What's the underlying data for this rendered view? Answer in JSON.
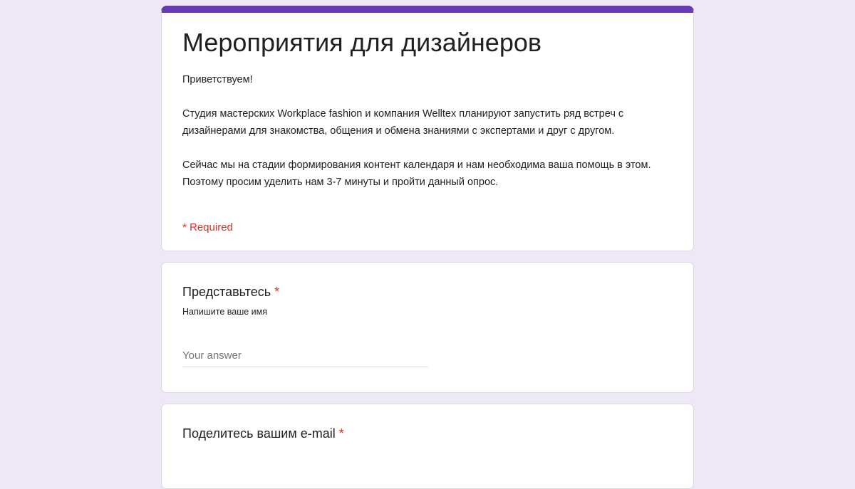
{
  "header": {
    "title": "Мероприятия для дизайнеров",
    "description": "Приветствуем!\n\nСтудия мастерских Workplace fashion и компания Welltex планируют запустить ряд встреч с дизайнерами для знакомства, общения и обмена знаниями с экспертами и друг с другом.\n\nСейчас мы на стадии формирования контент календаря и нам необходима ваша помощь в этом. Поэтому просим уделить нам 3-7 минуты и пройти данный опрос.",
    "required_note": "* Required",
    "accent_color": "#673ab7"
  },
  "questions": [
    {
      "title": "Представьтесь",
      "required_mark": "*",
      "help_text": "Напишите ваше имя",
      "placeholder": "Your answer",
      "value": ""
    },
    {
      "title": "Поделитесь вашим e-mail",
      "required_mark": "*"
    }
  ]
}
